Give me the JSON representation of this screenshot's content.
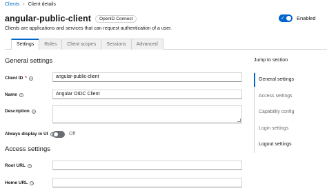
{
  "breadcrumb": {
    "root": "Clients",
    "separator": "›",
    "current": "Client details"
  },
  "header": {
    "title": "angular-public-client",
    "badge": "OpenID Connect",
    "enabled_label": "Enabled",
    "enabled": true,
    "subtitle": "Clients are applications and services that can request authentication of a user."
  },
  "tabs": [
    {
      "label": "Settings",
      "active": true
    },
    {
      "label": "Roles",
      "active": false
    },
    {
      "label": "Client scopes",
      "active": false
    },
    {
      "label": "Sessions",
      "active": false
    },
    {
      "label": "Advanced",
      "active": false
    }
  ],
  "general": {
    "title": "General settings",
    "client_id_label": "Client ID",
    "required_mark": "*",
    "client_id_value": "angular-public-client",
    "name_label": "Name",
    "name_value": "Angular OIDC Client",
    "description_label": "Description",
    "always_display_label": "Always display in UI",
    "always_display_state": "Off"
  },
  "access": {
    "title": "Access settings",
    "root_url_label": "Root URL",
    "home_url_label": "Home URL"
  },
  "jump": {
    "title": "Jump to section",
    "items": [
      "General settings",
      "Access settings",
      "Capability config",
      "Login settings",
      "Logout settings"
    ]
  },
  "icons": {
    "help": "help-circle-icon",
    "check": "check-icon"
  },
  "colors": {
    "accent": "#0066cc",
    "required": "#c9190b"
  }
}
